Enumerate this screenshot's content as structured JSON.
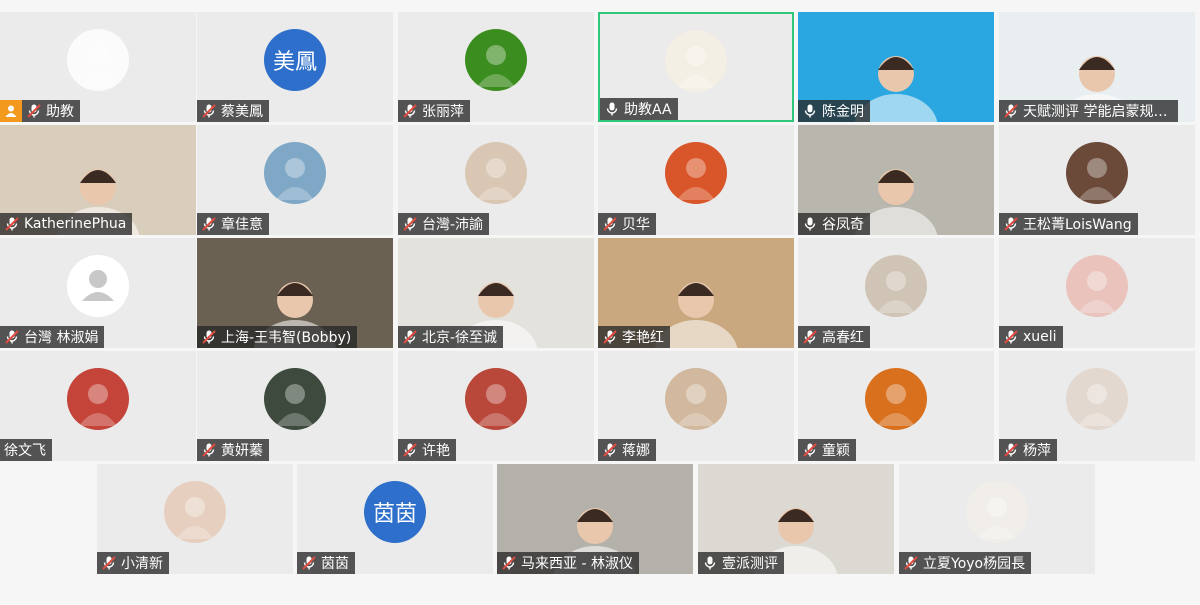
{
  "accent_color": "#2fc77a",
  "host_badge_color": "#f39a1e",
  "participants": [
    {
      "name": "助教",
      "mic": "muted",
      "host": true,
      "avatar": {
        "kind": "image",
        "icon": "swirl-logo-icon",
        "bg": "#fbfbfb"
      }
    },
    {
      "name": "蔡美鳳",
      "mic": "muted",
      "avatar": {
        "kind": "text",
        "text": "美鳳"
      }
    },
    {
      "name": "张丽萍",
      "mic": "muted",
      "avatar": {
        "kind": "image",
        "icon": "leaf-droplet-icon",
        "bg": "#3c8d1f"
      }
    },
    {
      "name": "助教AA",
      "mic": "on",
      "active": true,
      "avatar": {
        "kind": "image",
        "icon": "playing-card-icon",
        "bg": "#f4efe4"
      }
    },
    {
      "name": "陈金明",
      "mic": "on",
      "avatar": {
        "kind": "video",
        "bg": "#2aa7e0"
      }
    },
    {
      "name": "天赋测评 学能启蒙规划师 周晓英",
      "mic": "muted",
      "avatar": {
        "kind": "video",
        "bg": "#e9eef0"
      }
    },
    {
      "name": "KatherinePhua",
      "mic": "muted",
      "avatar": {
        "kind": "video",
        "bg": "#d9cdbb"
      }
    },
    {
      "name": "章佳意",
      "mic": "muted",
      "avatar": {
        "kind": "image",
        "icon": "castle-photo-icon",
        "bg": "#7fa8c7"
      }
    },
    {
      "name": "台灣-沛諭",
      "mic": "muted",
      "avatar": {
        "kind": "image",
        "icon": "profile-photo-icon",
        "bg": "#d9c7b4"
      }
    },
    {
      "name": "贝华",
      "mic": "muted",
      "avatar": {
        "kind": "image",
        "icon": "sunset-photo-icon",
        "bg": "#d9562a"
      }
    },
    {
      "name": "谷凤奇",
      "mic": "on",
      "avatar": {
        "kind": "video",
        "bg": "#b9b6ad"
      }
    },
    {
      "name": "王松菁LoisWang",
      "mic": "muted",
      "avatar": {
        "kind": "image",
        "icon": "portrait-photo-icon",
        "bg": "#6b4a3a"
      }
    },
    {
      "name": "台灣 林淑娟",
      "mic": "muted",
      "avatar": {
        "kind": "default",
        "icon": "person-silhouette-icon"
      }
    },
    {
      "name": "上海-王韦智(Bobby)",
      "mic": "muted",
      "avatar": {
        "kind": "video",
        "bg": "#6b6152"
      }
    },
    {
      "name": "北京-徐至诚",
      "mic": "muted",
      "avatar": {
        "kind": "video",
        "bg": "#e4e2dd"
      }
    },
    {
      "name": "李艳红",
      "mic": "muted",
      "avatar": {
        "kind": "video",
        "bg": "#c9a77f"
      }
    },
    {
      "name": "高春红",
      "mic": "muted",
      "avatar": {
        "kind": "image",
        "icon": "plush-toy-photo-icon",
        "bg": "#cfc4b5"
      }
    },
    {
      "name": "xueli",
      "mic": "muted",
      "avatar": {
        "kind": "image",
        "icon": "flower-photo-icon",
        "bg": "#e9c3bc"
      }
    },
    {
      "name": "徐文飞",
      "mic": "none",
      "avatar": {
        "kind": "image",
        "icon": "group-photo-icon",
        "bg": "#c4443a"
      }
    },
    {
      "name": "黄妍蓁",
      "mic": "muted",
      "avatar": {
        "kind": "image",
        "icon": "graduate-photo-icon",
        "bg": "#3d4a3d"
      }
    },
    {
      "name": "许艳",
      "mic": "muted",
      "avatar": {
        "kind": "image",
        "icon": "anime-girl-icon",
        "bg": "#b9473a"
      }
    },
    {
      "name": "蒋娜",
      "mic": "muted",
      "avatar": {
        "kind": "image",
        "icon": "woman-photo-icon",
        "bg": "#d2b89e"
      }
    },
    {
      "name": "童颖",
      "mic": "muted",
      "avatar": {
        "kind": "image",
        "icon": "dancer-photo-icon",
        "bg": "#d9701e"
      }
    },
    {
      "name": "杨萍",
      "mic": "muted",
      "avatar": {
        "kind": "image",
        "icon": "selfie-photo-icon",
        "bg": "#e3d8cf"
      }
    },
    {
      "name": "小清新",
      "mic": "muted",
      "avatar": {
        "kind": "image",
        "icon": "girl-profile-photo-icon",
        "bg": "#e7cfc0"
      }
    },
    {
      "name": "茵茵",
      "mic": "muted",
      "avatar": {
        "kind": "text",
        "text": "茵茵"
      }
    },
    {
      "name": "马来西亚 - 林淑仪",
      "mic": "muted",
      "avatar": {
        "kind": "video",
        "bg": "#b4b1ab"
      }
    },
    {
      "name": "壹派测评",
      "mic": "on",
      "avatar": {
        "kind": "video",
        "bg": "#dcd9d3"
      }
    },
    {
      "name": "立夏Yoyo杨园長",
      "mic": "muted",
      "avatar": {
        "kind": "image",
        "icon": "red-shirt-photo-icon",
        "bg": "#f1eee9"
      }
    }
  ]
}
